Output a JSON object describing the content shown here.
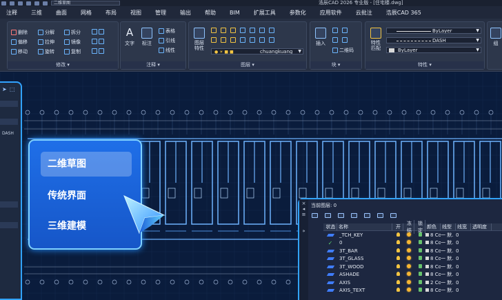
{
  "window": {
    "title": "浩辰CAD 2026 专业版 - [住宅楼.dwg]",
    "quick_access_combo": "二维草图"
  },
  "menu": [
    "注释",
    "三维",
    "曲面",
    "网格",
    "布局",
    "视图",
    "管理",
    "输出",
    "帮助",
    "BIM",
    "扩展工具",
    "参数化",
    "应用软件",
    "云批注",
    "浩辰CAD 365"
  ],
  "ribbon": {
    "modify": {
      "label": "修改 ▾",
      "tools": [
        "删除",
        "分解",
        "拆分",
        "偏移",
        "拉伸",
        "镜像",
        "移动",
        "旋转",
        "复制"
      ]
    },
    "annotate": {
      "label": "注释 ▾",
      "text": "文字",
      "dim": "标注",
      "table": "表格",
      "leader": "引线",
      "linear": "线性"
    },
    "layer": {
      "label": "图层 ▾",
      "props": "图层\n特性",
      "current_layer": "chuangkuang"
    },
    "block": {
      "label": "块 ▾",
      "insert": "插入",
      "qrcode": "二维码"
    },
    "properties": {
      "label": "特性 ▾",
      "match": "特性\n匹配",
      "color": "ByLayer",
      "linetype": "DASH",
      "lineweight": "ByLayer"
    },
    "group": {
      "label": "组"
    }
  },
  "left_dock": {
    "dash_label": "DASH"
  },
  "feature_menu": {
    "items": [
      "二维草图",
      "传统界面",
      "三维建模"
    ],
    "active_index": 0
  },
  "layer_panel": {
    "current": "当前图层: 0",
    "side_labels": [
      "×",
      "◂",
      "≡",
      "»"
    ],
    "headers": [
      "状态",
      "名称",
      "开",
      "冻结",
      "锁定",
      "颜色",
      "线型",
      "线宽",
      "透明度"
    ],
    "rows": [
      {
        "status": "layer",
        "name": "_TCH_KEY",
        "color": "8",
        "color_label": "Co...",
        "linetype": "一 默.",
        "lineweight": "0"
      },
      {
        "status": "current",
        "name": "0",
        "color": "8",
        "color_label": "Co...",
        "linetype": "一 默.",
        "lineweight": "0"
      },
      {
        "status": "layer",
        "name": "3T_BAR",
        "color": "8",
        "color_label": "Co...",
        "linetype": "一 默.",
        "lineweight": "0"
      },
      {
        "status": "layer",
        "name": "3T_GLASS",
        "color": "8",
        "color_label": "Co...",
        "linetype": "一 默.",
        "lineweight": "0"
      },
      {
        "status": "layer",
        "name": "3T_WOOD",
        "color": "8",
        "color_label": "Co...",
        "linetype": "一 默.",
        "lineweight": "0"
      },
      {
        "status": "layer",
        "name": "ASHADE",
        "color": "8",
        "color_label": "Co...",
        "linetype": "一 默.",
        "lineweight": "0"
      },
      {
        "status": "layer",
        "name": "AXIS",
        "color": "2",
        "color_label": "Co...",
        "linetype": "一 默.",
        "lineweight": "0"
      },
      {
        "status": "layer",
        "name": "AXIS_TEXT",
        "color": "8",
        "color_label": "Co...",
        "linetype": "一 默.",
        "lineweight": "0"
      }
    ]
  }
}
